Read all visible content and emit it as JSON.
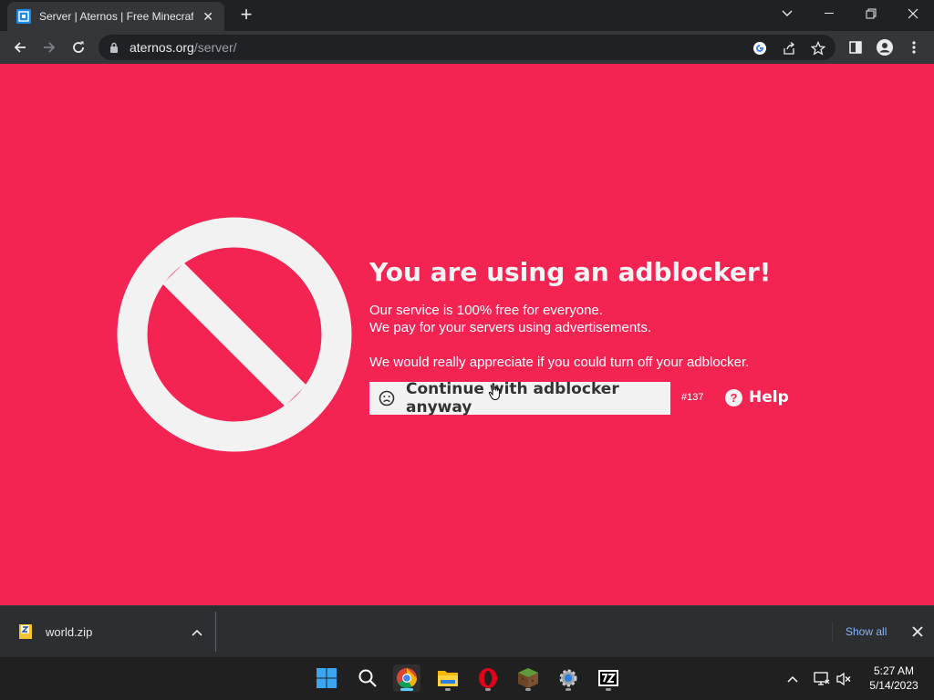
{
  "browser": {
    "tab": {
      "title": "Server | Aternos | Free Minecraft Server",
      "favicon": "aternos-favicon"
    },
    "new_tab_label": "+",
    "url_host": "aternos.org",
    "url_path": "/server/",
    "window_controls": [
      "minimize",
      "restore",
      "close"
    ]
  },
  "page": {
    "background": "#f42452",
    "icon": "prohibited-icon",
    "headline": "You are using an adblocker!",
    "line1": "Our service is 100% free for everyone.",
    "line2": "We pay for your servers using advertisements.",
    "line3": "We would really appreciate if you could turn off your adblocker.",
    "continue_label": "Continue with adblocker anyway",
    "code": "#137",
    "help_icon": "?",
    "help_label": "Help"
  },
  "downloads": {
    "file_name": "world.zip",
    "show_all": "Show all"
  },
  "taskbar": {
    "apps": [
      "start",
      "search",
      "chrome",
      "file-explorer",
      "opera",
      "minecraft",
      "settings",
      "7zip"
    ],
    "time": "5:27 AM",
    "date": "5/14/2023"
  }
}
